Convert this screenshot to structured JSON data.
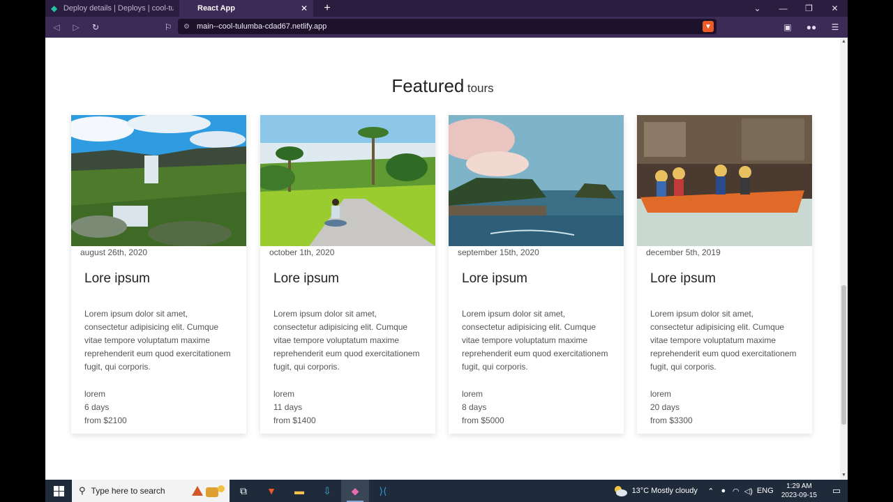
{
  "browser": {
    "tabs": [
      {
        "title": "Deploy details | Deploys | cool-tulumb",
        "active": false
      },
      {
        "title": "React App",
        "active": true
      }
    ],
    "url": "main--cool-tulumba-cdad67.netlify.app"
  },
  "section": {
    "title_main": "Featured",
    "title_sub": "tours"
  },
  "tours": [
    {
      "date": "august 26th, 2020",
      "title": "Lore ipsum",
      "description": "Lorem ipsum dolor sit amet, consectetur adipisicing elit. Cumque vitae tempore voluptatum maxime reprehenderit eum quod exercitationem fugit, qui corporis.",
      "location": "lorem",
      "duration": "6 days",
      "price": "from $2100",
      "image": "waterfall-landscape"
    },
    {
      "date": "october 1th, 2020",
      "title": "Lore ipsum",
      "description": "Lorem ipsum dolor sit amet, consectetur adipisicing elit. Cumque vitae tempore voluptatum maxime reprehenderit eum quod exercitationem fugit, qui corporis.",
      "location": "lorem",
      "duration": "11 days",
      "price": "from $1400",
      "image": "palm-road"
    },
    {
      "date": "september 15th, 2020",
      "title": "Lore ipsum",
      "description": "Lorem ipsum dolor sit amet, consectetur adipisicing elit. Cumque vitae tempore voluptatum maxime reprehenderit eum quod exercitationem fugit, qui corporis.",
      "location": "lorem",
      "duration": "8 days",
      "price": "from $5000",
      "image": "sea-temple"
    },
    {
      "date": "december 5th, 2019",
      "title": "Lore ipsum",
      "description": "Lorem ipsum dolor sit amet, consectetur adipisicing elit. Cumque vitae tempore voluptatum maxime reprehenderit eum quod exercitationem fugit, qui corporis.",
      "location": "lorem",
      "duration": "20 days",
      "price": "from $3300",
      "image": "boat-market"
    }
  ],
  "taskbar": {
    "search_placeholder": "Type here to search",
    "weather": "13°C  Mostly cloudy",
    "language": "ENG",
    "time": "1:29 AM",
    "date": "2023-09-15"
  },
  "colors": {
    "browser_frame": "#2b1d3f",
    "browser_toolbar": "#3c2a57",
    "taskbar": "#1f2a3a"
  }
}
